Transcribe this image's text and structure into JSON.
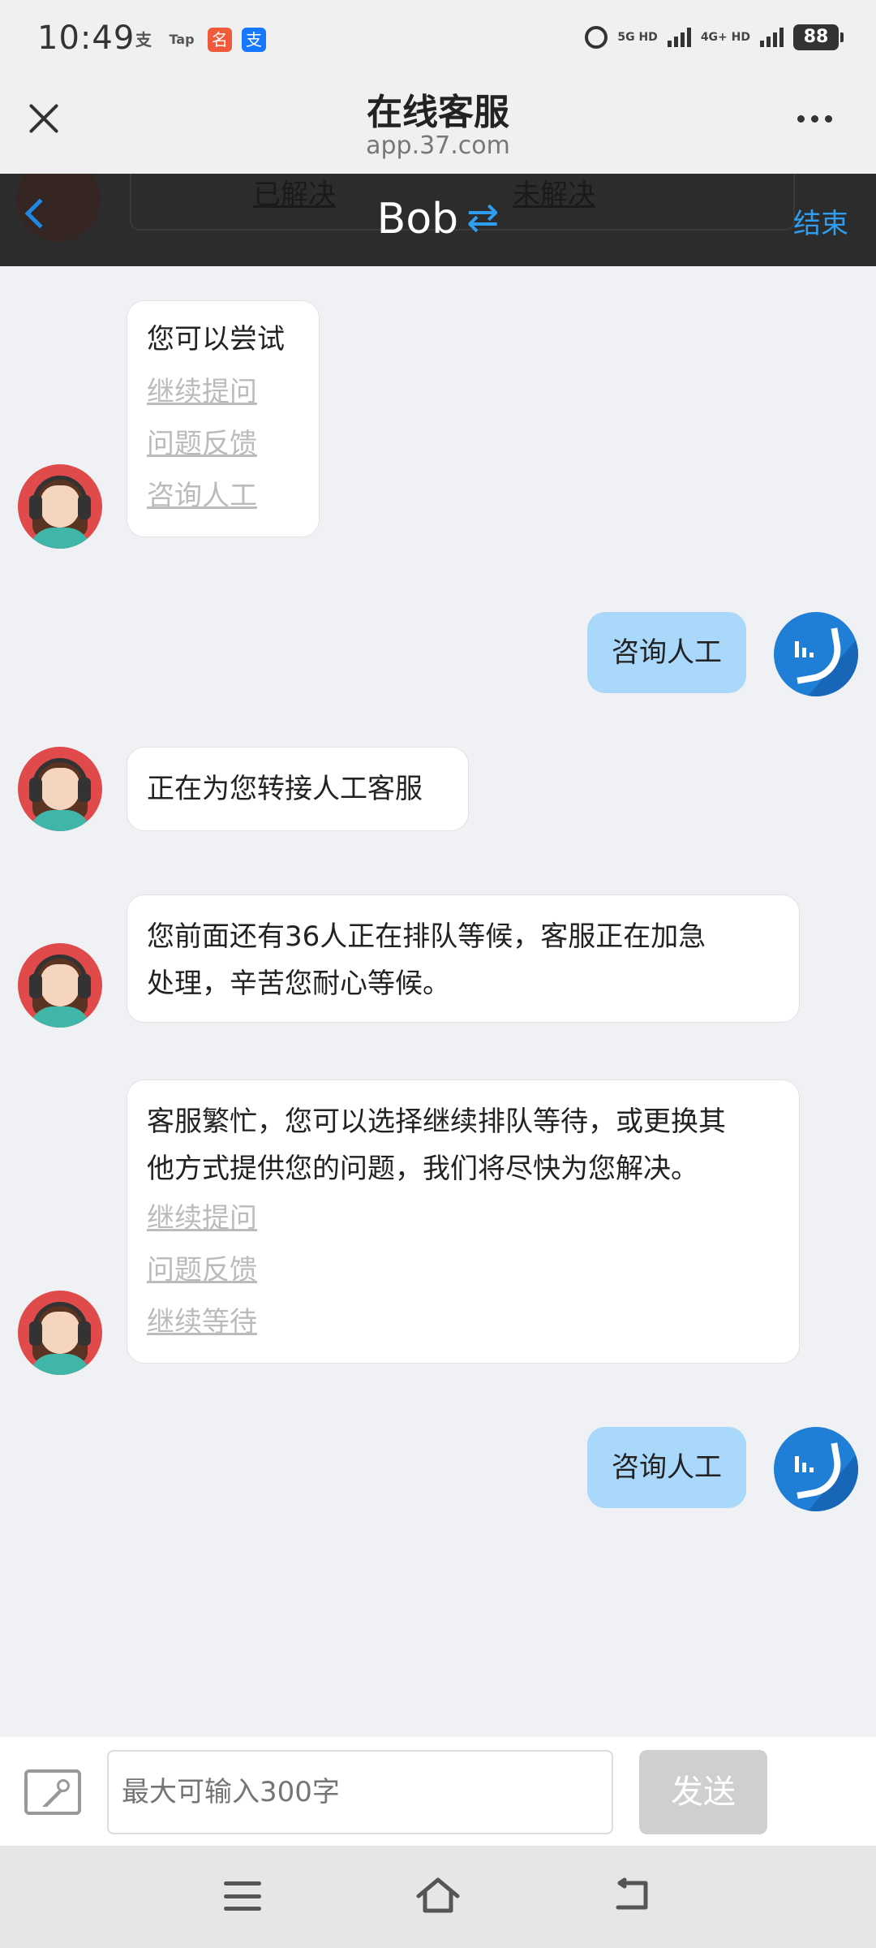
{
  "status_bar": {
    "time": "10:49",
    "app_icons": [
      "支",
      "Tap",
      "名",
      "支"
    ],
    "network_left": "5G HD",
    "network_right": "4G+ HD",
    "battery": "88"
  },
  "browser": {
    "title": "在线客服",
    "url": "app.37.com"
  },
  "chat_header": {
    "agent_name": "Bob",
    "swap_symbol": "⇄",
    "end_label": "结束",
    "ghost_left": "已解决",
    "ghost_right": "未解决"
  },
  "messages": [
    {
      "from": "agent",
      "text": "您可以尝试",
      "links": [
        "继续提问",
        "问题反馈",
        "咨询人工"
      ]
    },
    {
      "from": "user",
      "text": "咨询人工"
    },
    {
      "from": "agent",
      "text": "正在为您转接人工客服"
    },
    {
      "from": "agent",
      "text_lines": [
        "您前面还有36人正在排队等候，客服正在加急",
        "处理，辛苦您耐心等候。"
      ]
    },
    {
      "from": "agent",
      "text_lines": [
        "客服繁忙，您可以选择继续排队等待，或更换其",
        "他方式提供您的问题，我们将尽快为您解决。"
      ],
      "links": [
        "继续提问",
        "问题反馈",
        "继续等待"
      ]
    },
    {
      "from": "user",
      "text": "咨询人工"
    }
  ],
  "input": {
    "placeholder": "最大可输入300字",
    "send_label": "发送"
  },
  "colors": {
    "accent": "#2f9df0",
    "user_bubble": "#a9d8fb",
    "header_dark": "#2c2c2c"
  }
}
